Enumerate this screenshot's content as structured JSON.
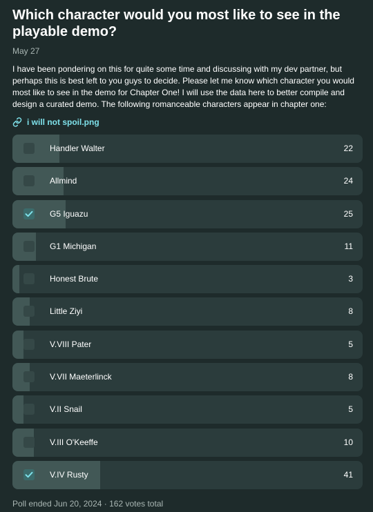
{
  "post": {
    "title": "Which character would you most like to see in the playable demo?",
    "date": "May 27",
    "body": "I have been pondering on this for quite some time and discussing with my dev partner, but perhaps this is best left to you guys to decide. Please let me know which character you would most like to see in the demo for Chapter One! I will use the data here to better compile and design a curated demo. The following romanceable characters appear in chapter one:",
    "attachment": {
      "icon": "link-icon",
      "label": "i will not spoil.png"
    }
  },
  "poll": {
    "total_votes": 162,
    "options": [
      {
        "label": "Handler Walter",
        "votes": "22",
        "share": 0.136,
        "checked": false
      },
      {
        "label": "Allmind",
        "votes": "24",
        "share": 0.148,
        "checked": false
      },
      {
        "label": "G5 Iguazu",
        "votes": "25",
        "share": 0.154,
        "checked": true
      },
      {
        "label": "G1 Michigan",
        "votes": "11",
        "share": 0.068,
        "checked": false
      },
      {
        "label": "Honest Brute",
        "votes": "3",
        "share": 0.019,
        "checked": false
      },
      {
        "label": "Little Ziyi",
        "votes": "8",
        "share": 0.049,
        "checked": false
      },
      {
        "label": "V.VIII Pater",
        "votes": "5",
        "share": 0.031,
        "checked": false
      },
      {
        "label": "V.VII Maeterlinck",
        "votes": "8",
        "share": 0.049,
        "checked": false
      },
      {
        "label": "V.II Snail",
        "votes": "5",
        "share": 0.031,
        "checked": false
      },
      {
        "label": "V.III O'Keeffe",
        "votes": "10",
        "share": 0.062,
        "checked": false
      },
      {
        "label": "V.IV Rusty",
        "votes": "41",
        "share": 0.253,
        "checked": true
      }
    ],
    "footer": "Poll ended Jun 20, 2024 · 162 votes total"
  },
  "colors": {
    "background": "#1e2b2b",
    "option_bg": "#2b3c3c",
    "option_fill": "#425856",
    "accent_link": "#7ee0e9",
    "muted_text": "#a9b6b3"
  }
}
